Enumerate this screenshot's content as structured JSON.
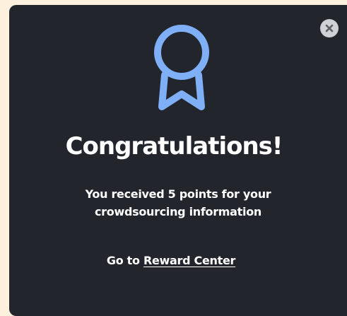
{
  "modal": {
    "title": "Congratulations!",
    "message_line1": "You received 5 points for your",
    "message_line2": "crowdsourcing information",
    "reward_prefix": "Go to",
    "reward_link": "Reward Center"
  },
  "icons": {
    "award": "award-ribbon-icon",
    "close": "close-icon"
  },
  "colors": {
    "page_background": "#fdf0dc",
    "modal_background": "#22252c",
    "award_accent": "#7fb0f7",
    "close_button_background": "#cfd1d4",
    "close_icon": "#5b5f66",
    "text": "#ffffff"
  }
}
